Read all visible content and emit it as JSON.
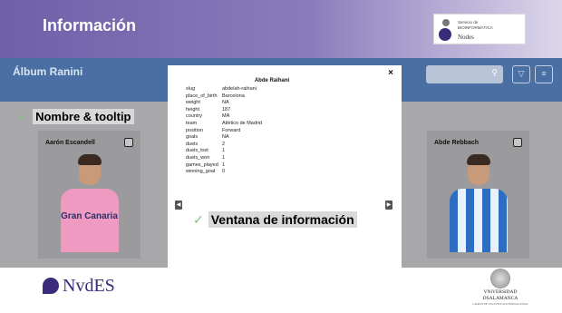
{
  "header": {
    "title": "Información",
    "logo_line1": "Servicio de",
    "logo_line2": "BIOINFORMÁTICA",
    "logo_line3": "Nodes"
  },
  "app": {
    "title": "Álbum Ranini",
    "search_icon": "search-icon",
    "filter_icon": "filter-icon",
    "menu_icon": "menu-icon"
  },
  "annotations": {
    "tooltip_label": "Nombre & tooltip",
    "window_label": "Ventana de información"
  },
  "cards": [
    {
      "name": "Aarón Escandell",
      "shirt_text": "Gran Canaria"
    },
    {
      "name": "Abde Rebbach",
      "shirt_text": ""
    }
  ],
  "modal": {
    "heading": "Abde Raihani",
    "close": "×",
    "rows": [
      {
        "k": "slug",
        "v": "abdelah-raihani"
      },
      {
        "k": "place_of_birth",
        "v": "Barcelona"
      },
      {
        "k": "weight",
        "v": "NA"
      },
      {
        "k": "height",
        "v": "187"
      },
      {
        "k": "country",
        "v": "MA"
      },
      {
        "k": "team",
        "v": "Atlético de Madrid"
      },
      {
        "k": "position",
        "v": "Forward"
      },
      {
        "k": "goals",
        "v": "NA"
      },
      {
        "k": "duels",
        "v": "2"
      },
      {
        "k": "duels_lost",
        "v": "1"
      },
      {
        "k": "duels_won",
        "v": "1"
      },
      {
        "k": "games_played",
        "v": "1"
      },
      {
        "k": "winning_goal",
        "v": "0"
      }
    ]
  },
  "footer": {
    "nodes_text": "NvdES",
    "usal_line1": "VNiVERSiDAD",
    "usal_line2": "DSALAMANCA",
    "usal_line3": "CAMPUS DE EXCELENCIA INTERNACIONAL"
  }
}
